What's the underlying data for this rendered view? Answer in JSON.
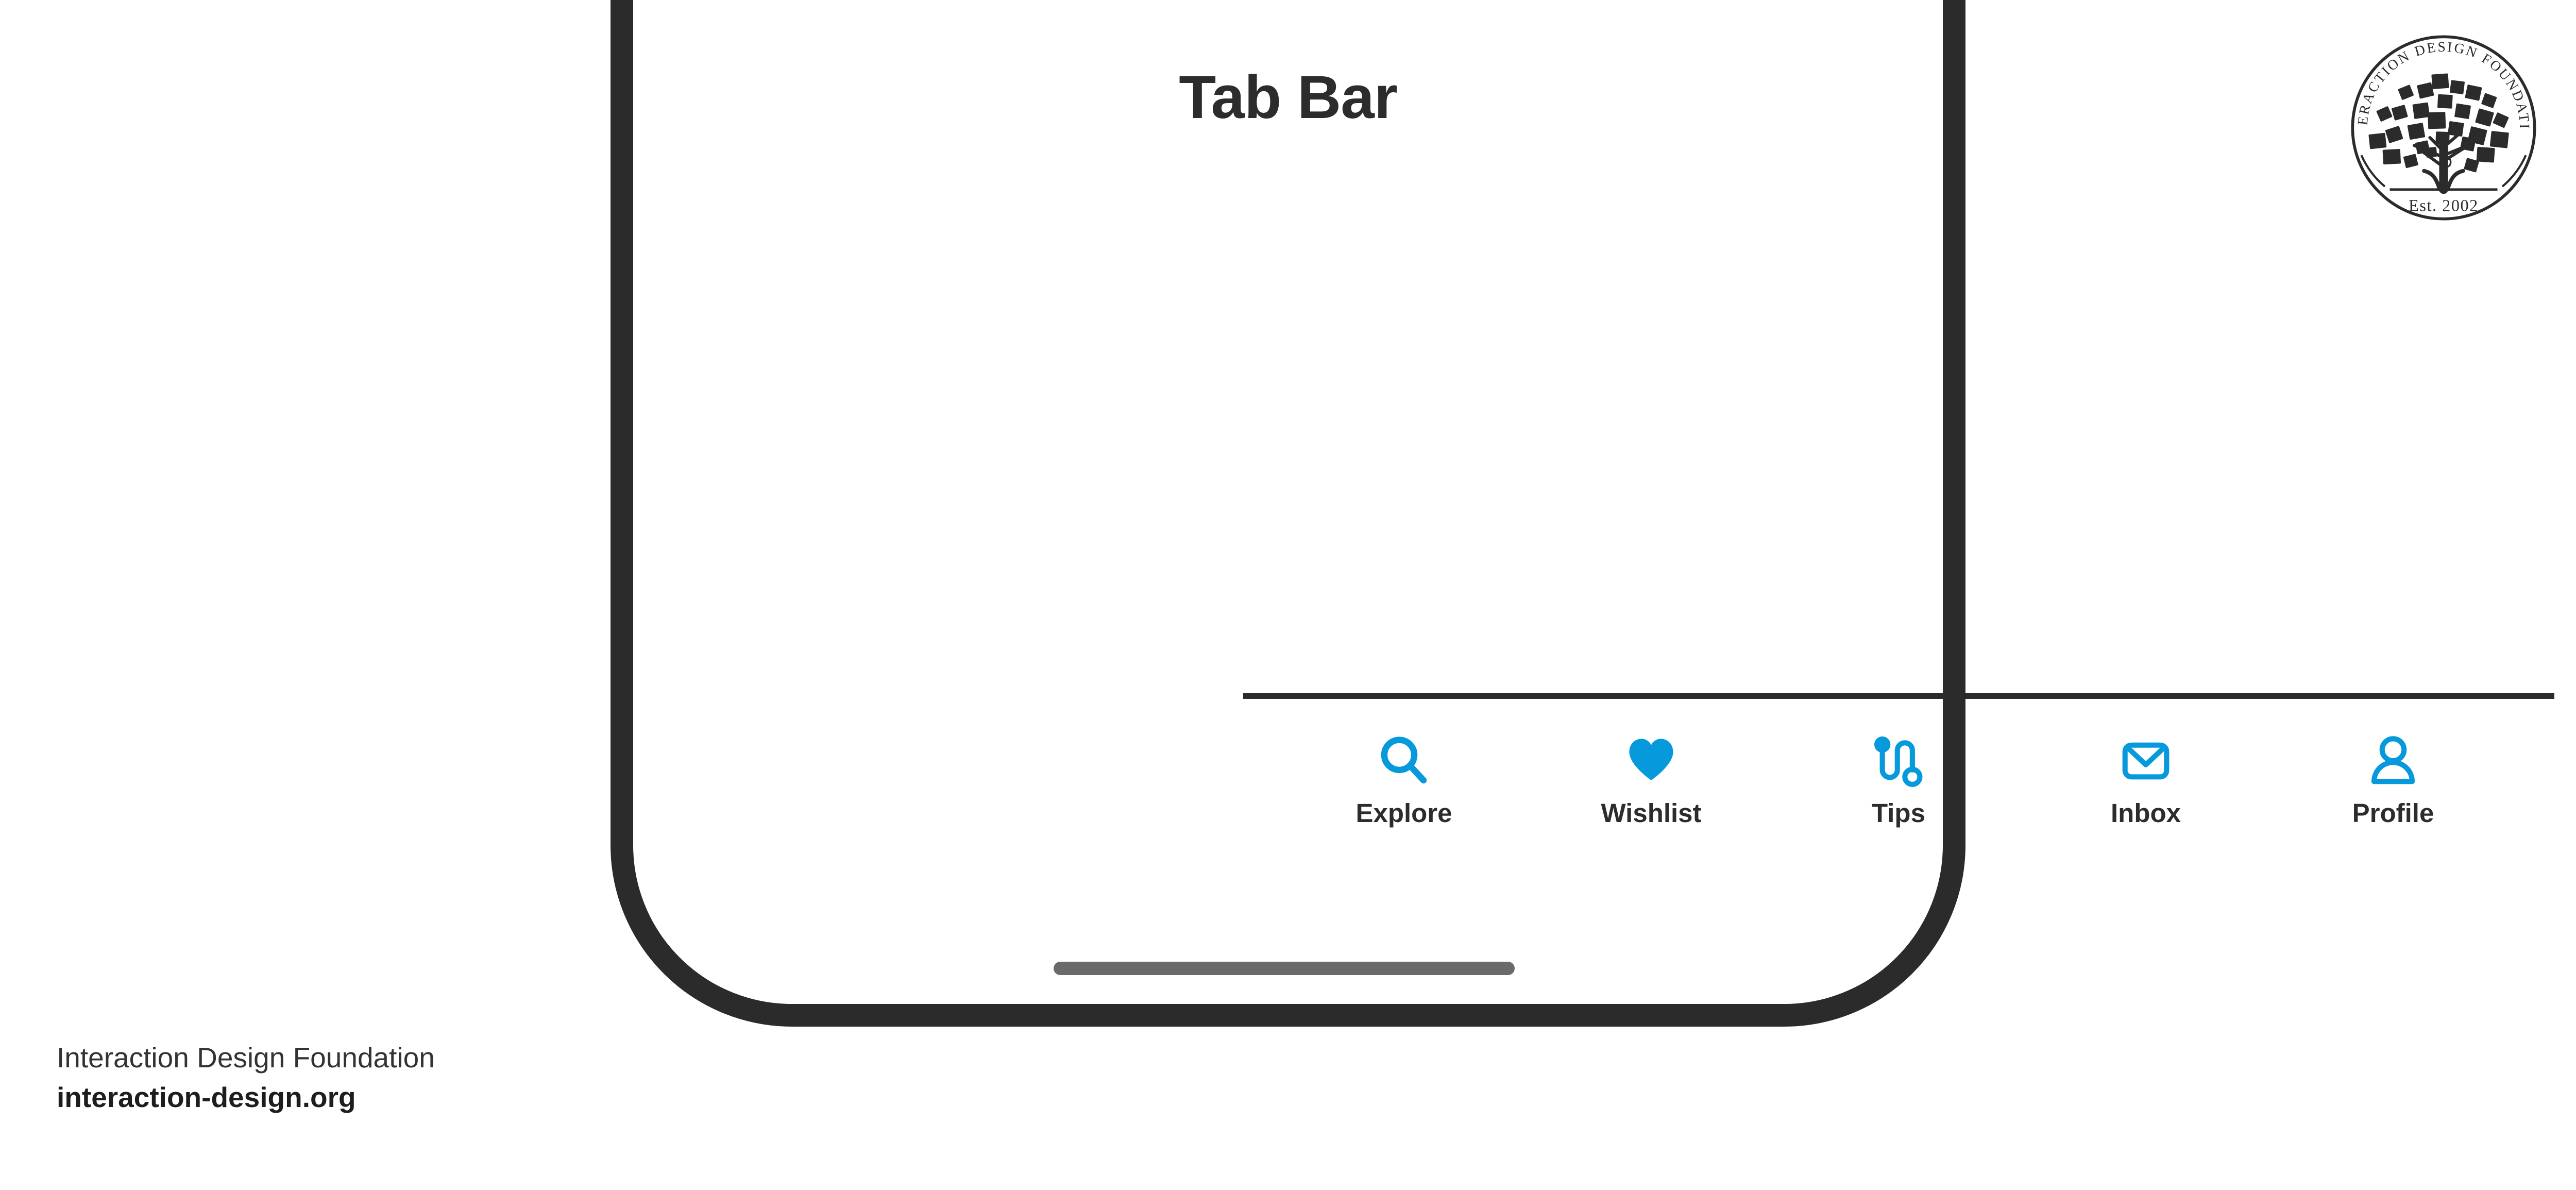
{
  "page": {
    "title": "Tab Bar",
    "background_color": "#ffffff"
  },
  "colors": {
    "accent_blue": "#0699db",
    "frame_dark": "#2b2b2b",
    "text_dark": "#2c2c2c",
    "home_indicator_gray": "#6a6a6a"
  },
  "phone": {
    "screen_label": "phone-screen",
    "home_indicator_label": "home-indicator"
  },
  "tabbar": {
    "items": [
      {
        "label": "Explore",
        "icon": "search-icon"
      },
      {
        "label": "Wishlist",
        "icon": "heart-icon"
      },
      {
        "label": "Tips",
        "icon": "path-tips-icon"
      },
      {
        "label": "Inbox",
        "icon": "envelope-icon"
      },
      {
        "label": "Profile",
        "icon": "person-icon"
      }
    ]
  },
  "footer": {
    "organization": "Interaction Design Foundation",
    "website": "interaction-design.org"
  },
  "logo": {
    "arc_text": "INTERACTION DESIGN FOUNDATION",
    "established": "Est. 2002",
    "emblem": "tree-icon"
  }
}
